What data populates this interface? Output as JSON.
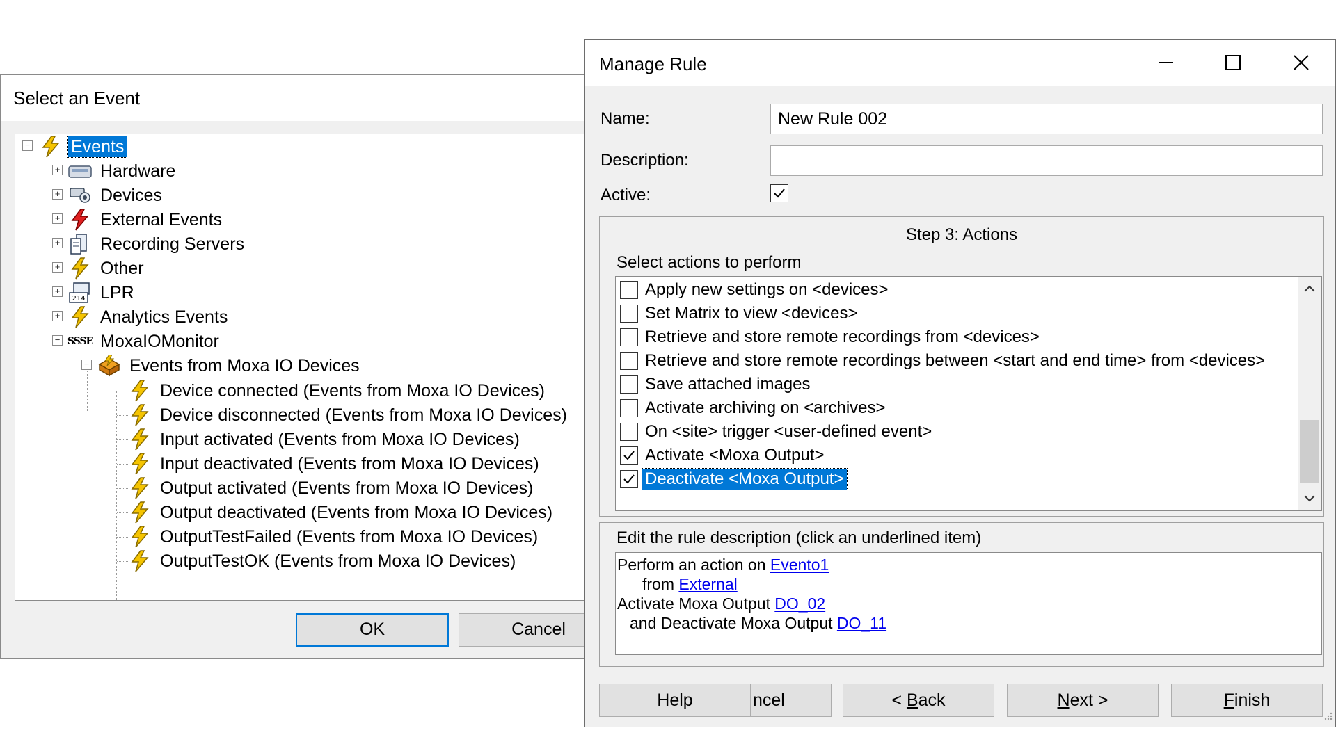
{
  "select_event": {
    "title": "Select an Event",
    "tree": {
      "root": "Events",
      "items": [
        {
          "label": "Hardware",
          "icon": "hardware-icon"
        },
        {
          "label": "Devices",
          "icon": "devices-icon"
        },
        {
          "label": "External Events",
          "icon": "external-events-icon"
        },
        {
          "label": "Recording Servers",
          "icon": "recording-servers-icon"
        },
        {
          "label": "Other",
          "icon": "lightning-icon"
        },
        {
          "label": "LPR",
          "icon": "lpr-icon"
        },
        {
          "label": "Analytics Events",
          "icon": "lightning-icon"
        },
        {
          "label": "MoxaIOMonitor",
          "icon": "sdk-icon"
        }
      ],
      "sdk_icon_text": "SSSE",
      "lpr_icon_text": "214",
      "group": "Events from Moxa IO Devices",
      "events": [
        "Device connected (Events from Moxa IO Devices)",
        "Device disconnected (Events from Moxa IO Devices)",
        "Input activated (Events from Moxa IO Devices)",
        "Input deactivated (Events from Moxa IO Devices)",
        "Output activated (Events from Moxa IO Devices)",
        "Output deactivated (Events from Moxa IO Devices)",
        "OutputTestFailed (Events from Moxa IO Devices)",
        "OutputTestOK (Events from Moxa IO Devices)"
      ]
    },
    "ok_label": "OK",
    "cancel_label": "Cancel"
  },
  "manage_rule": {
    "title": "Manage Rule",
    "name_label": "Name:",
    "name_value": "New Rule 002",
    "description_label": "Description:",
    "description_value": "",
    "active_label": "Active:",
    "active_checked": true,
    "step_title": "Step 3: Actions",
    "select_actions_label": "Select actions to perform",
    "actions": [
      {
        "label": "Apply new settings on <devices>",
        "checked": false
      },
      {
        "label": "Set Matrix to view <devices>",
        "checked": false
      },
      {
        "label": "Retrieve and store remote recordings from <devices>",
        "checked": false
      },
      {
        "label": "Retrieve and store remote recordings between <start and end time> from <devices>",
        "checked": false
      },
      {
        "label": "Save attached images",
        "checked": false
      },
      {
        "label": "Activate archiving on <archives>",
        "checked": false
      },
      {
        "label": "On <site> trigger <user-defined event>",
        "checked": false
      },
      {
        "label": "Activate <Moxa Output>",
        "checked": true
      },
      {
        "label": "Deactivate <Moxa Output>",
        "checked": true,
        "selected": true
      }
    ],
    "edit_description_label": "Edit the rule description (click an underlined item)",
    "description_lines": {
      "l1_text": "Perform an action on ",
      "l1_link": "Evento1",
      "l2_text": "from ",
      "l2_link": "External",
      "l3_text": "Activate Moxa Output ",
      "l3_link": "DO_02",
      "l4_text": "and Deactivate Moxa Output ",
      "l4_link": "DO_11"
    },
    "buttons": {
      "help": "Help",
      "cancel": "ncel",
      "back_prefix": "< ",
      "back_mnemonic": "B",
      "back_rest": "ack",
      "next_mnemonic": "N",
      "next_rest": "ext >",
      "finish_mnemonic": "F",
      "finish_rest": "inish"
    }
  }
}
